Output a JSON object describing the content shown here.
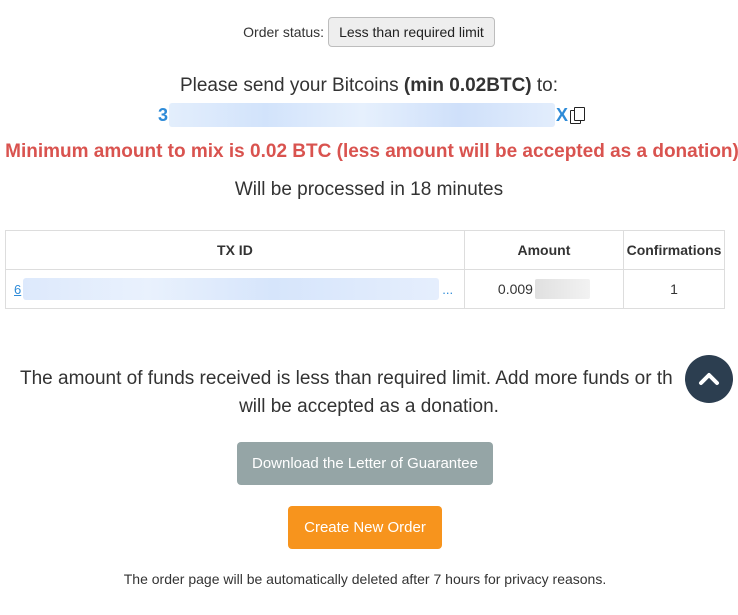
{
  "order": {
    "status_label": "Order status:",
    "status_value": "Less than required limit"
  },
  "send": {
    "prefix": "Please send your Bitcoins ",
    "min_text": "(min 0.02BTC)",
    "suffix": " to:",
    "address_start": "3",
    "address_end": "X"
  },
  "warning": "Minimum amount to mix is 0.02 BTC (less amount will be accepted as a donation)",
  "processing": "Will be processed in 18 minutes",
  "table": {
    "headers": [
      "TX ID",
      "Amount",
      "Confirmations"
    ],
    "rows": [
      {
        "txid_start": "6",
        "txid_ellipsis": "...",
        "amount_start": "0.009",
        "confirmations": "1"
      }
    ]
  },
  "info": {
    "line1": "The amount of funds received is less than required limit. Add more funds or th",
    "line2": "will be accepted as a donation."
  },
  "buttons": {
    "guarantee": "Download the Letter of Guarantee",
    "create": "Create New Order"
  },
  "footer": "The order page will be automatically deleted after 7 hours for privacy reasons.",
  "colors": {
    "warning": "#d9534f",
    "link": "#2e8bd8",
    "guarantee_button": "#95a5a6",
    "create_button": "#f7941d",
    "scroll_button": "#2c3e50"
  },
  "icons": {
    "copy": "copy-icon",
    "scroll_top": "chevron-up-icon"
  }
}
